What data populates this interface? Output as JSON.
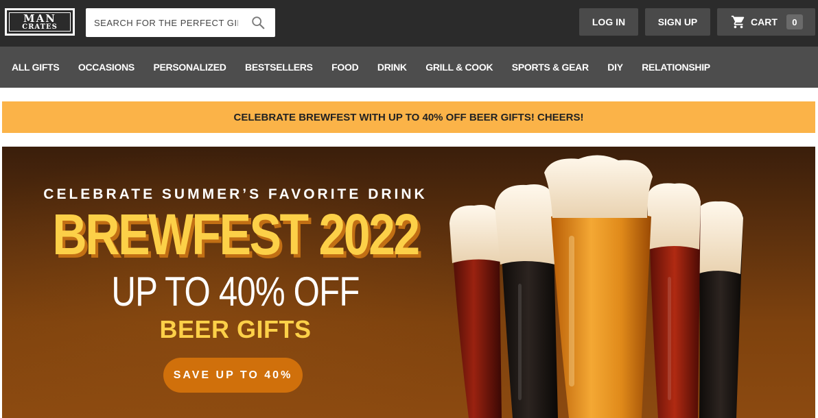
{
  "header": {
    "logo": {
      "line1": "MAN",
      "line2": "CRATES"
    },
    "search": {
      "placeholder": "SEARCH FOR THE PERFECT GIFT",
      "icon": "search-icon"
    },
    "login_label": "LOG IN",
    "signup_label": "SIGN UP",
    "cart": {
      "label": "CART",
      "count": "0",
      "icon": "cart-icon"
    }
  },
  "nav": {
    "items": [
      {
        "label": "ALL GIFTS"
      },
      {
        "label": "OCCASIONS"
      },
      {
        "label": "PERSONALIZED"
      },
      {
        "label": "BESTSELLERS"
      },
      {
        "label": "FOOD"
      },
      {
        "label": "DRINK"
      },
      {
        "label": "GRILL & COOK"
      },
      {
        "label": "SPORTS & GEAR"
      },
      {
        "label": "DIY"
      },
      {
        "label": "RELATIONSHIP"
      }
    ]
  },
  "promo": {
    "text": "CELEBRATE BREWFEST WITH UP TO 40% OFF BEER GIFTS! CHEERS!"
  },
  "hero": {
    "kicker": "CELEBRATE SUMMER’S FAVORITE DRINK",
    "headline": "BREWFEST 2022",
    "offer": "UP TO 40% OFF",
    "subhead": "BEER GIFTS",
    "cta_label": "SAVE UP TO 40%"
  },
  "colors": {
    "topbar": "#2b2b2b",
    "nav": "#4d4d4d",
    "promo": "#fbb348",
    "headline_yellow": "#fcd048",
    "cta_orange": "#d0700b"
  }
}
